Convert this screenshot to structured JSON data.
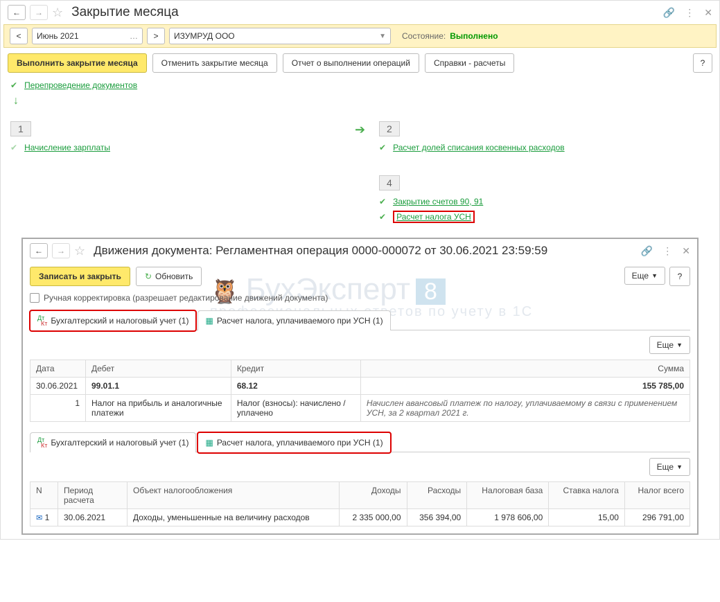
{
  "main": {
    "title": "Закрытие месяца",
    "period": "Июнь 2021",
    "org": "ИЗУМРУД ООО",
    "state_label": "Состояние:",
    "state_value": "Выполнено",
    "actions": {
      "run": "Выполнить закрытие месяца",
      "cancel": "Отменить закрытие месяца",
      "report": "Отчет о выполнении операций",
      "refs": "Справки - расчеты",
      "help": "?"
    },
    "repost": "Перепроведение документов",
    "col1": {
      "num": "1",
      "salary": "Начисление зарплаты"
    },
    "col2": {
      "num": "2",
      "indirect": "Расчет долей списания косвенных расходов"
    },
    "col4": {
      "num": "4",
      "close9091": "Закрытие счетов 90, 91",
      "usn": "Расчет налога УСН"
    }
  },
  "dlg": {
    "title": "Движения документа: Регламентная операция 0000-000072 от 30.06.2021 23:59:59",
    "save": "Записать и закрыть",
    "refresh": "Обновить",
    "more": "Еще",
    "help": "?",
    "manual": "Ручная корректировка (разрешает редактирование движений документа)",
    "tab1": "Бухгалтерский и налоговый учет (1)",
    "tab2": "Расчет налога, уплачиваемого при УСН (1)",
    "watermark1": "БухЭксперт",
    "watermark2": "профессиональных ответов по учету в 1С",
    "t1": {
      "h": {
        "date": "Дата",
        "debit": "Дебет",
        "credit": "Кредит",
        "sum": "Сумма"
      },
      "r": {
        "date": "30.06.2021",
        "n": "1",
        "debit": "99.01.1",
        "credit": "68.12",
        "sum": "155 785,00",
        "debit2": "Налог на прибыль и аналогичные платежи",
        "credit2": "Налог (взносы): начислено / уплачено",
        "note": "Начислен авансовый платеж по налогу, уплачиваемому в связи с применением УСН, за 2 квартал 2021 г."
      }
    },
    "t2": {
      "h": {
        "n": "N",
        "period": "Период расчета",
        "obj": "Объект налогообложения",
        "income": "Доходы",
        "exp": "Расходы",
        "base": "Налоговая база",
        "rate": "Ставка налога",
        "tax": "Налог всего"
      },
      "r": {
        "n": "1",
        "period": "30.06.2021",
        "obj": "Доходы, уменьшенные на величину расходов",
        "income": "2 335 000,00",
        "exp": "356 394,00",
        "base": "1 978 606,00",
        "rate": "15,00",
        "tax": "296 791,00"
      }
    }
  }
}
